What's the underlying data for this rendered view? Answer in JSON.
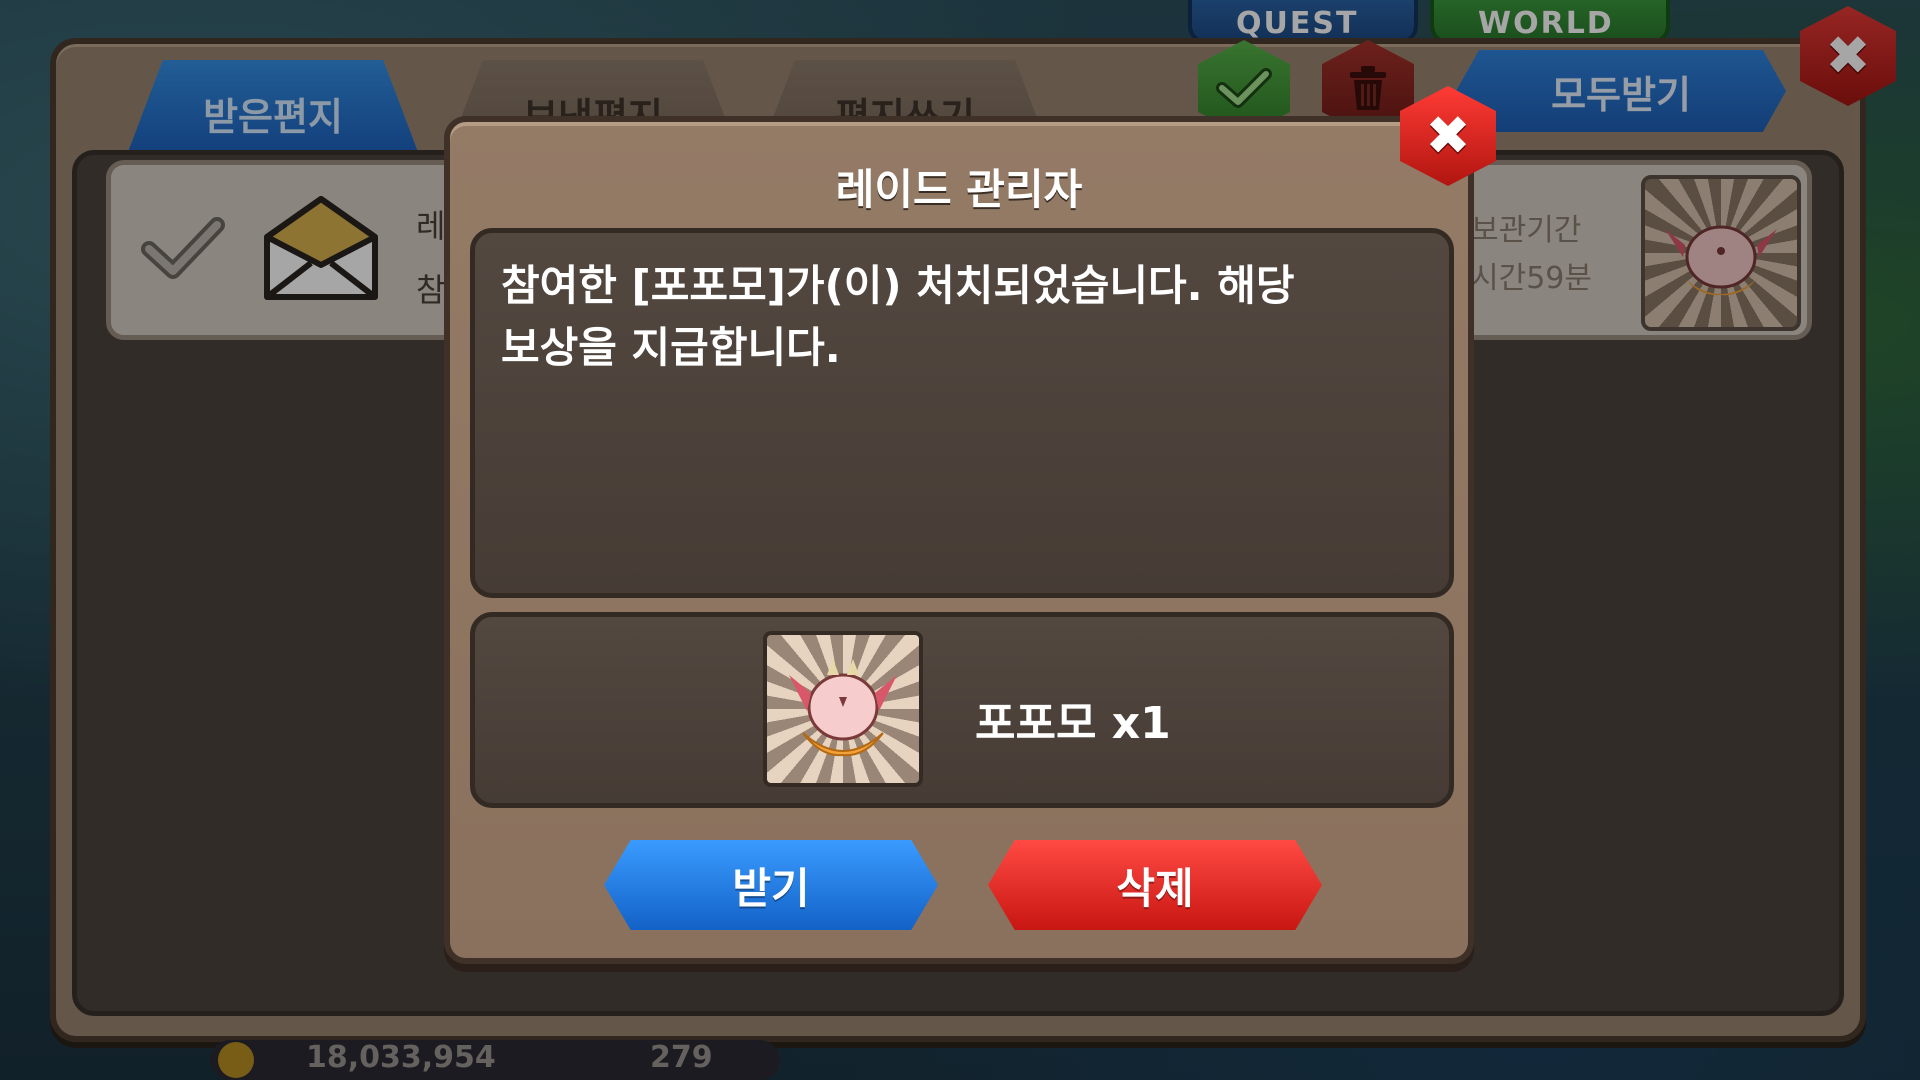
{
  "hud": {
    "quest_label": "QUEST",
    "world_label": "WORLD",
    "gold": "18,033,954",
    "stamina": "279"
  },
  "mailbox": {
    "tabs": [
      {
        "label": "받은편지"
      },
      {
        "label": "보낸편지"
      },
      {
        "label": "편지쓰기"
      }
    ],
    "claim_all_label": "모두받기",
    "row": {
      "title_fragment": "레",
      "preview_fragment": "참",
      "expiry_label": "보관기간",
      "expiry_time": "시간59분"
    }
  },
  "dialog": {
    "title": "레이드 관리자",
    "message_line1": "참여한 [포포모]가(이) 처치되었습니다. 해당",
    "message_line2": "보상을 지급합니다.",
    "reward_label": "포포모 x1",
    "receive_label": "받기",
    "delete_label": "삭제"
  },
  "colors": {
    "accent_blue": "#1e63bf",
    "accent_red": "#c81612",
    "panel_brown": "#947b66"
  }
}
